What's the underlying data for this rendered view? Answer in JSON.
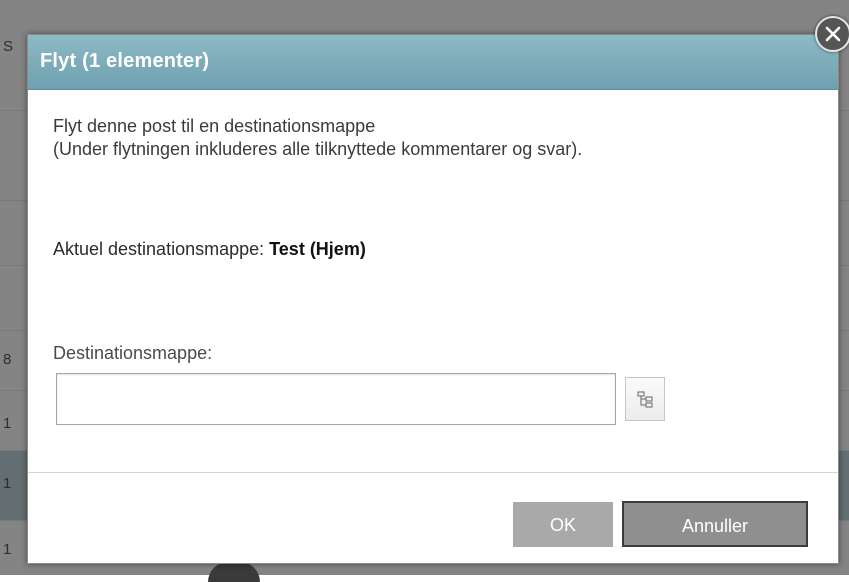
{
  "background": {
    "header_fragment": "S",
    "row_fragments": [
      "8",
      "1",
      "1",
      "1"
    ]
  },
  "dialog": {
    "title": "Flyt (1 elementer)",
    "message_line1": "Flyt denne post til en destinationsmappe",
    "message_line2": "(Under flytningen inkluderes alle tilknyttede kommentarer og svar).",
    "current_label": "Aktuel destinationsmappe: ",
    "current_value": "Test (Hjem)",
    "destination_label": "Destinationsmappe:",
    "destination_value": "",
    "ok_label": "OK",
    "cancel_label": "Annuller"
  },
  "icons": {
    "close": "close-icon",
    "tree": "folder-tree-icon"
  },
  "colors": {
    "header": "#7aabba",
    "ok_button": "#a9a9a9",
    "cancel_button": "#8f8f8f"
  }
}
